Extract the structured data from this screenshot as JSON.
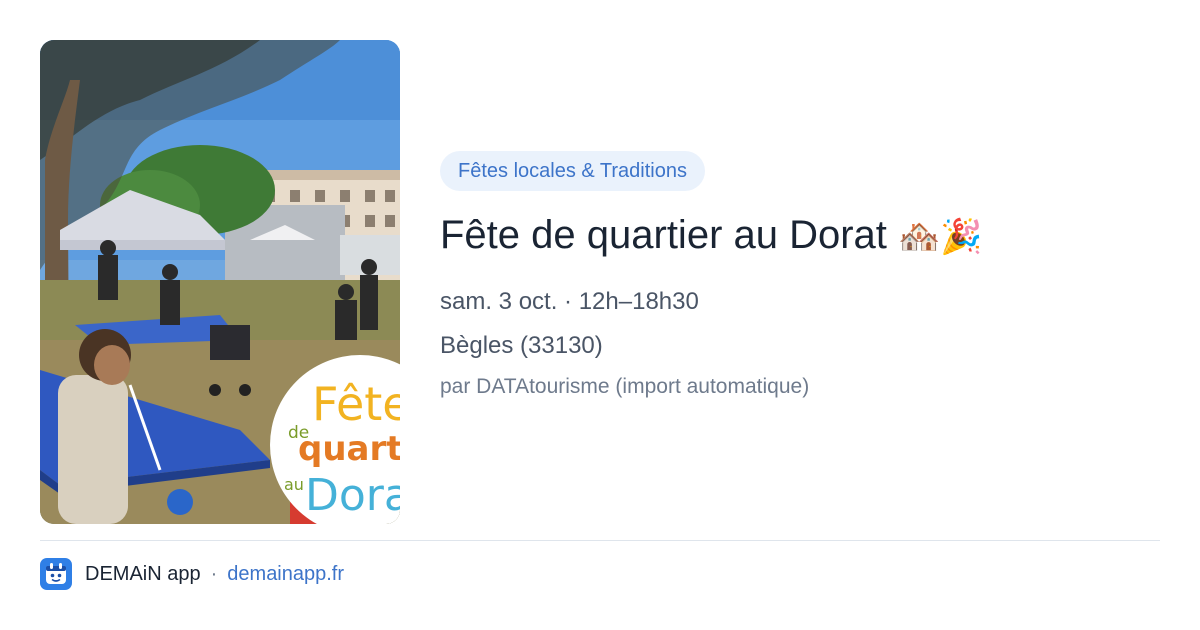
{
  "event": {
    "category": "Fêtes locales & Traditions",
    "title": "Fête de quartier au Dorat",
    "title_emoji": "🏘️🎉",
    "date": "sam. 3 oct. · 12h–18h30",
    "city": "Bègles (33130)",
    "author": "par DATAtourisme (import automatique)",
    "image_overlay": {
      "line1": "Fête",
      "line2": "de",
      "line3": "quartier",
      "line4": "au",
      "line5": "Dorat"
    }
  },
  "footer": {
    "app_name": "DEMAiN app",
    "separator": "·",
    "site": "demainapp.fr",
    "logo_icon": "calendar-face-icon"
  },
  "colors": {
    "accent": "#3d74c9",
    "chip_bg": "#eaf2fc",
    "title": "#1a2433",
    "muted": "#4a5566",
    "logo_bg": "#2f7fe6"
  }
}
